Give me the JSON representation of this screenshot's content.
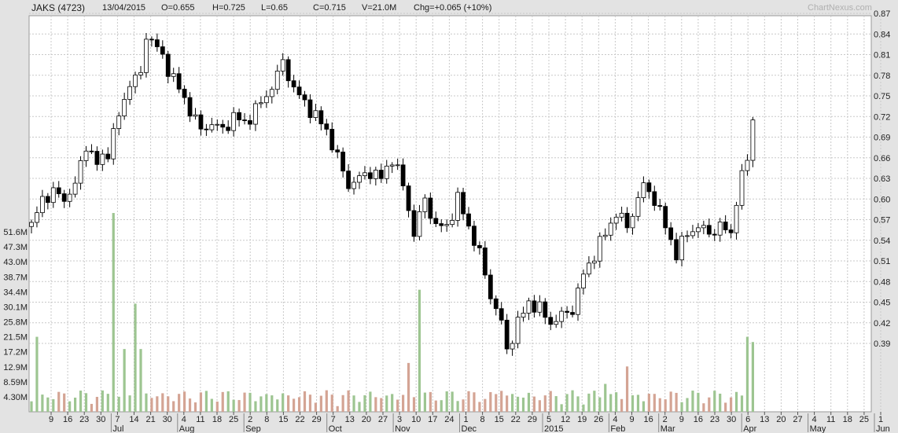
{
  "header": {
    "symbol": "JAKS (4723)",
    "date": "13/04/2015",
    "open": "O=0.655",
    "high": "H=0.725",
    "low": "L=0.65",
    "close": "C=0.715",
    "volume": "V=21.0M",
    "change": "Chg=+0.065 (+10%)",
    "brand": "ChartNexus.com"
  },
  "colors": {
    "volume_up": "#9dc591",
    "volume_down": "#d4a494",
    "grid": "#c8c8c8"
  },
  "chart_data": [
    {
      "type": "candlestick",
      "name": "price",
      "ylim": [
        0.36,
        0.875
      ],
      "right_axis_ticks": [
        "0.87",
        "0.84",
        "0.81",
        "0.78",
        "0.75",
        "0.72",
        "0.69",
        "0.66",
        "0.63",
        "0.60",
        "0.57",
        "0.54",
        "0.51",
        "0.48",
        "0.45",
        "0.42",
        "0.39"
      ],
      "x_day_ticks": [
        "9",
        "16",
        "23",
        "30",
        "7",
        "14",
        "21",
        "30",
        "4",
        "11",
        "18",
        "25",
        "2",
        "8",
        "15",
        "22",
        "29",
        "7",
        "13",
        "20",
        "27",
        "3",
        "10",
        "17",
        "24",
        "1",
        "8",
        "15",
        "22",
        "29",
        "5",
        "12",
        "19",
        "26",
        "4",
        "9",
        "16",
        "2",
        "9",
        "16",
        "23",
        "30",
        "6",
        "13",
        "20",
        "27",
        "4",
        "11",
        "18",
        "25",
        "1"
      ],
      "x_month_labels": [
        "Jul",
        "Aug",
        "Sep",
        "Oct",
        "Nov",
        "Dec",
        "2015",
        "Feb",
        "Mar",
        "Apr",
        "May",
        "Jun"
      ],
      "close_points": [
        [
          0,
          0.56
        ],
        [
          2,
          0.6
        ],
        [
          4,
          0.61
        ],
        [
          6,
          0.6
        ],
        [
          8,
          0.62
        ],
        [
          10,
          0.68
        ],
        [
          12,
          0.65
        ],
        [
          14,
          0.67
        ],
        [
          16,
          0.72
        ],
        [
          18,
          0.77
        ],
        [
          20,
          0.78
        ],
        [
          21,
          0.84
        ],
        [
          23,
          0.82
        ],
        [
          25,
          0.79
        ],
        [
          27,
          0.76
        ],
        [
          29,
          0.73
        ],
        [
          31,
          0.7
        ],
        [
          33,
          0.71
        ],
        [
          35,
          0.7
        ],
        [
          37,
          0.72
        ],
        [
          39,
          0.71
        ],
        [
          41,
          0.73
        ],
        [
          43,
          0.75
        ],
        [
          45,
          0.78
        ],
        [
          46,
          0.8
        ],
        [
          48,
          0.76
        ],
        [
          50,
          0.74
        ],
        [
          52,
          0.72
        ],
        [
          54,
          0.7
        ],
        [
          56,
          0.66
        ],
        [
          58,
          0.62
        ],
        [
          60,
          0.63
        ],
        [
          62,
          0.64
        ],
        [
          64,
          0.63
        ],
        [
          66,
          0.66
        ],
        [
          68,
          0.62
        ],
        [
          70,
          0.55
        ],
        [
          72,
          0.6
        ],
        [
          74,
          0.56
        ],
        [
          76,
          0.56
        ],
        [
          78,
          0.6
        ],
        [
          80,
          0.56
        ],
        [
          82,
          0.52
        ],
        [
          84,
          0.46
        ],
        [
          86,
          0.42
        ],
        [
          87,
          0.38
        ],
        [
          89,
          0.42
        ],
        [
          91,
          0.45
        ],
        [
          93,
          0.44
        ],
        [
          95,
          0.42
        ],
        [
          97,
          0.43
        ],
        [
          99,
          0.44
        ],
        [
          101,
          0.49
        ],
        [
          103,
          0.52
        ],
        [
          105,
          0.55
        ],
        [
          107,
          0.58
        ],
        [
          109,
          0.56
        ],
        [
          111,
          0.6
        ],
        [
          112,
          0.62
        ],
        [
          114,
          0.6
        ],
        [
          116,
          0.56
        ],
        [
          118,
          0.52
        ],
        [
          120,
          0.55
        ],
        [
          122,
          0.56
        ],
        [
          124,
          0.55
        ],
        [
          126,
          0.56
        ],
        [
          128,
          0.55
        ],
        [
          129,
          0.6
        ],
        [
          130,
          0.63
        ],
        [
          131,
          0.66
        ],
        [
          132,
          0.715
        ]
      ],
      "close_on": "2015-04-13",
      "close": 0.715
    },
    {
      "type": "bar",
      "name": "volume",
      "ylim": [
        0,
        55
      ],
      "y_ticks": [
        "51.6M",
        "47.3M",
        "43.0M",
        "38.7M",
        "34.4M",
        "30.1M",
        "25.8M",
        "21.5M",
        "17.2M",
        "12.9M",
        "8.59M",
        "4.30M"
      ],
      "peaks_M": [
        [
          1,
          21.5
        ],
        [
          15,
          57
        ],
        [
          17,
          18
        ],
        [
          19,
          31
        ],
        [
          20,
          18
        ],
        [
          69,
          14
        ],
        [
          71,
          35
        ],
        [
          86,
          6
        ],
        [
          105,
          8
        ],
        [
          109,
          13
        ],
        [
          131,
          21.5
        ],
        [
          132,
          20
        ]
      ]
    }
  ]
}
